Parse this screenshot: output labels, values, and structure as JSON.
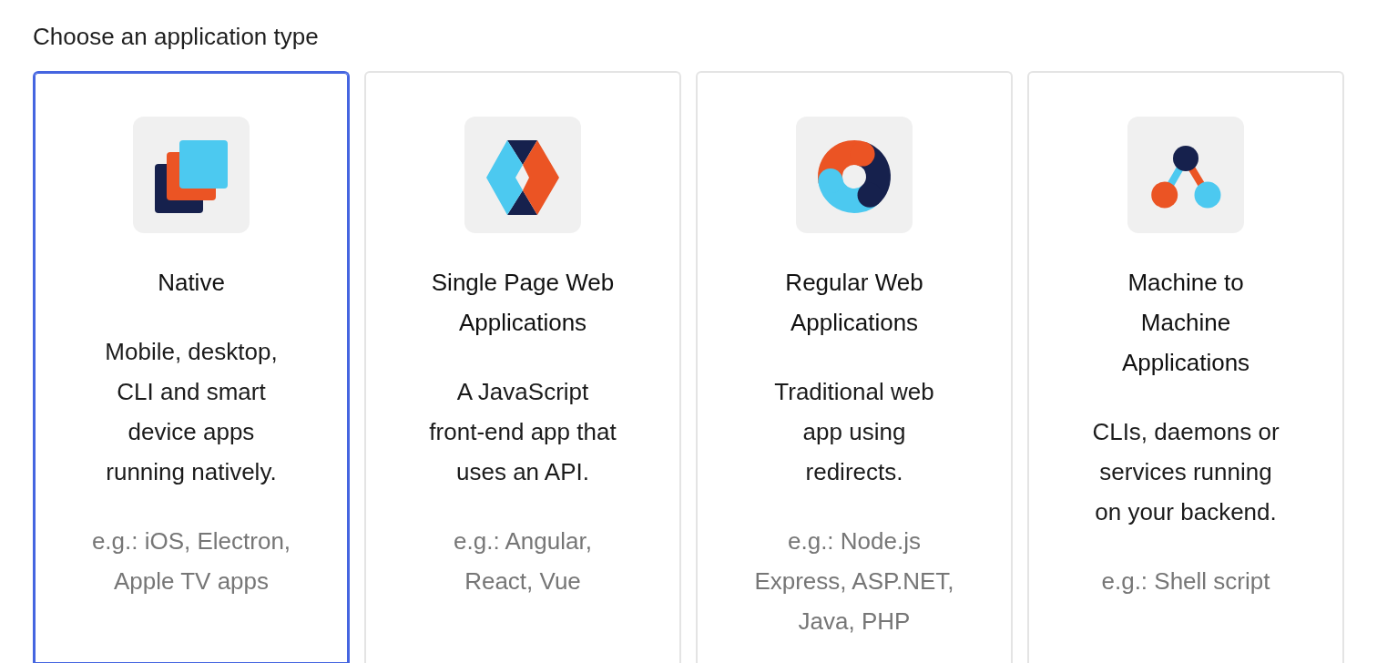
{
  "heading": "Choose an application type",
  "cards": [
    {
      "kind": "native",
      "title": "Native",
      "description": "Mobile, desktop, CLI and smart device apps running natively.",
      "examples": "e.g.: iOS, Electron, Apple TV apps",
      "selected": true
    },
    {
      "kind": "spa",
      "title": "Single Page Web Applications",
      "description": "A JavaScript front-end app that uses an API.",
      "examples": "e.g.: Angular, React, Vue",
      "selected": false
    },
    {
      "kind": "web",
      "title": "Regular Web Applications",
      "description": "Traditional web app using redirects.",
      "examples": "e.g.: Node.js Express, ASP.NET, Java, PHP",
      "selected": false
    },
    {
      "kind": "m2m",
      "title": "Machine to Machine Applications",
      "description": "CLIs, daemons or services running on your backend.",
      "examples": "e.g.: Shell script",
      "selected": false
    }
  ]
}
